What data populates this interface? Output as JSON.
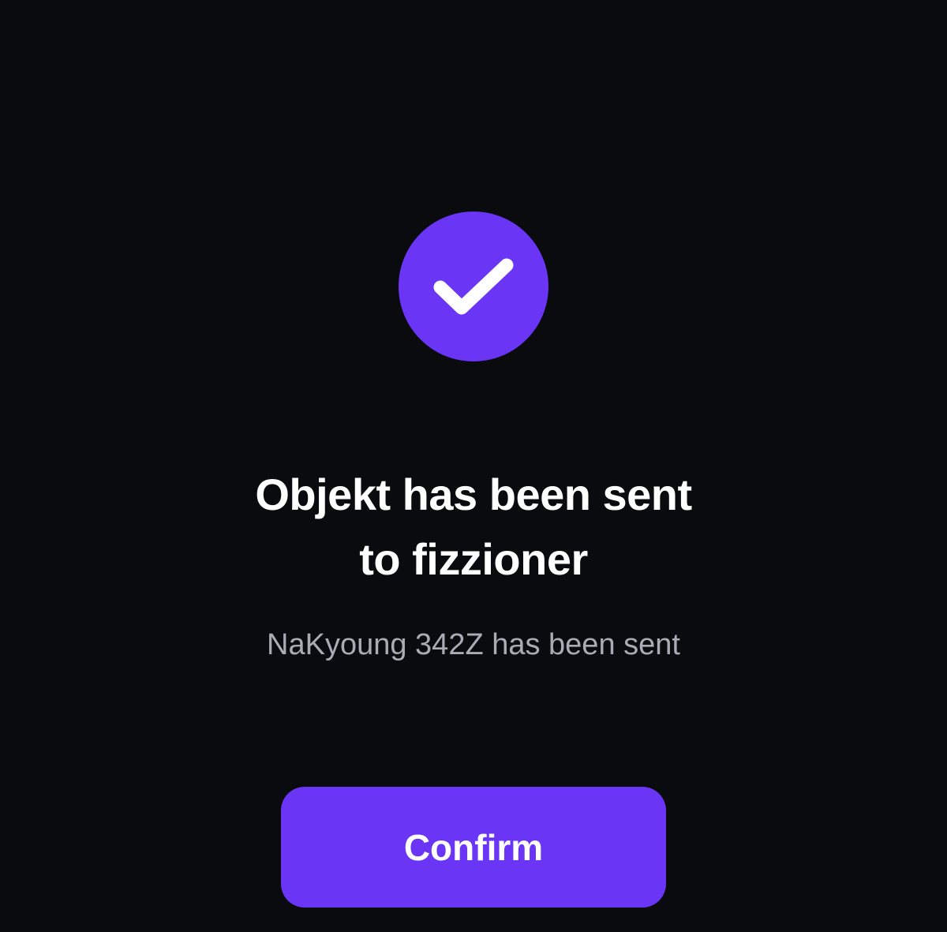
{
  "dialog": {
    "title_line1": "Objekt has been sent",
    "title_line2": "to fizzioner",
    "message": "NaKyoung 342Z has been sent",
    "confirm_label": "Confirm",
    "icon": "check-icon"
  },
  "colors": {
    "background": "#0a0b0e",
    "accent": "#6a35f5",
    "title_text": "#ffffff",
    "message_text": "#a9acb4"
  }
}
